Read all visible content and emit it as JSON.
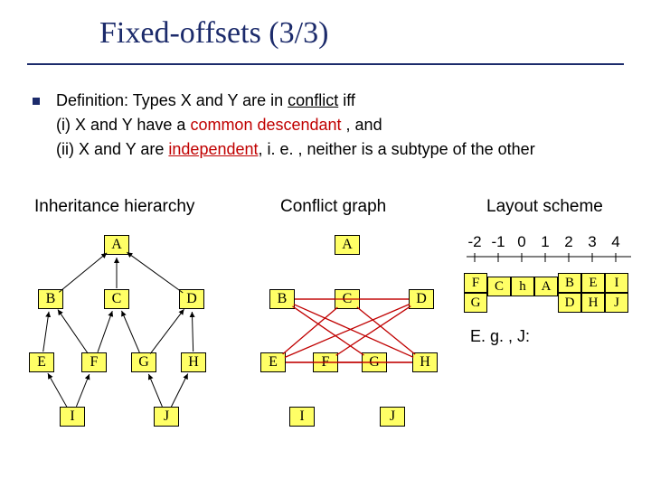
{
  "title": "Fixed-offsets (3/3)",
  "definition": {
    "lead": "Definition: Types X and Y are in ",
    "conflict": "conflict",
    "iff": " iff",
    "line_i_a": "(i)  X and Y have a ",
    "common_desc": "common descendant",
    "line_i_b": " , and",
    "line_ii_a": "(ii) X and Y are ",
    "independent": "independent",
    "line_ii_b": ", i. e. , neither is a subtype of the other"
  },
  "labels": {
    "inheritance": "Inheritance hierarchy",
    "conflict": "Conflict graph",
    "layout": "Layout scheme"
  },
  "nodes": [
    "A",
    "B",
    "C",
    "D",
    "E",
    "F",
    "G",
    "H",
    "I",
    "J"
  ],
  "inheritance_edges": [
    [
      "B",
      "A"
    ],
    [
      "C",
      "A"
    ],
    [
      "D",
      "A"
    ],
    [
      "E",
      "B"
    ],
    [
      "F",
      "B"
    ],
    [
      "F",
      "C"
    ],
    [
      "G",
      "C"
    ],
    [
      "G",
      "D"
    ],
    [
      "H",
      "D"
    ],
    [
      "I",
      "E"
    ],
    [
      "I",
      "F"
    ],
    [
      "J",
      "G"
    ],
    [
      "J",
      "H"
    ]
  ],
  "conflict_edges": [
    [
      "B",
      "C"
    ],
    [
      "B",
      "D"
    ],
    [
      "C",
      "D"
    ],
    [
      "E",
      "F"
    ],
    [
      "E",
      "G"
    ],
    [
      "E",
      "H"
    ],
    [
      "F",
      "G"
    ],
    [
      "F",
      "H"
    ],
    [
      "G",
      "H"
    ],
    [
      "B",
      "G"
    ],
    [
      "B",
      "H"
    ],
    [
      "C",
      "E"
    ],
    [
      "C",
      "H"
    ],
    [
      "D",
      "E"
    ],
    [
      "D",
      "F"
    ]
  ],
  "scale": [
    "-2",
    "-1",
    "0",
    "1",
    "2",
    "3",
    "4"
  ],
  "layout_cells": {
    "row0": {
      "-2": "F",
      "-1": "C",
      "0": "h",
      "1": "A",
      "2": "B",
      "3": "E",
      "4": "I"
    },
    "row1": {
      "-2": "G",
      "2": "D",
      "3": "H",
      "4": "J"
    }
  },
  "eg": "E. g. , J:"
}
